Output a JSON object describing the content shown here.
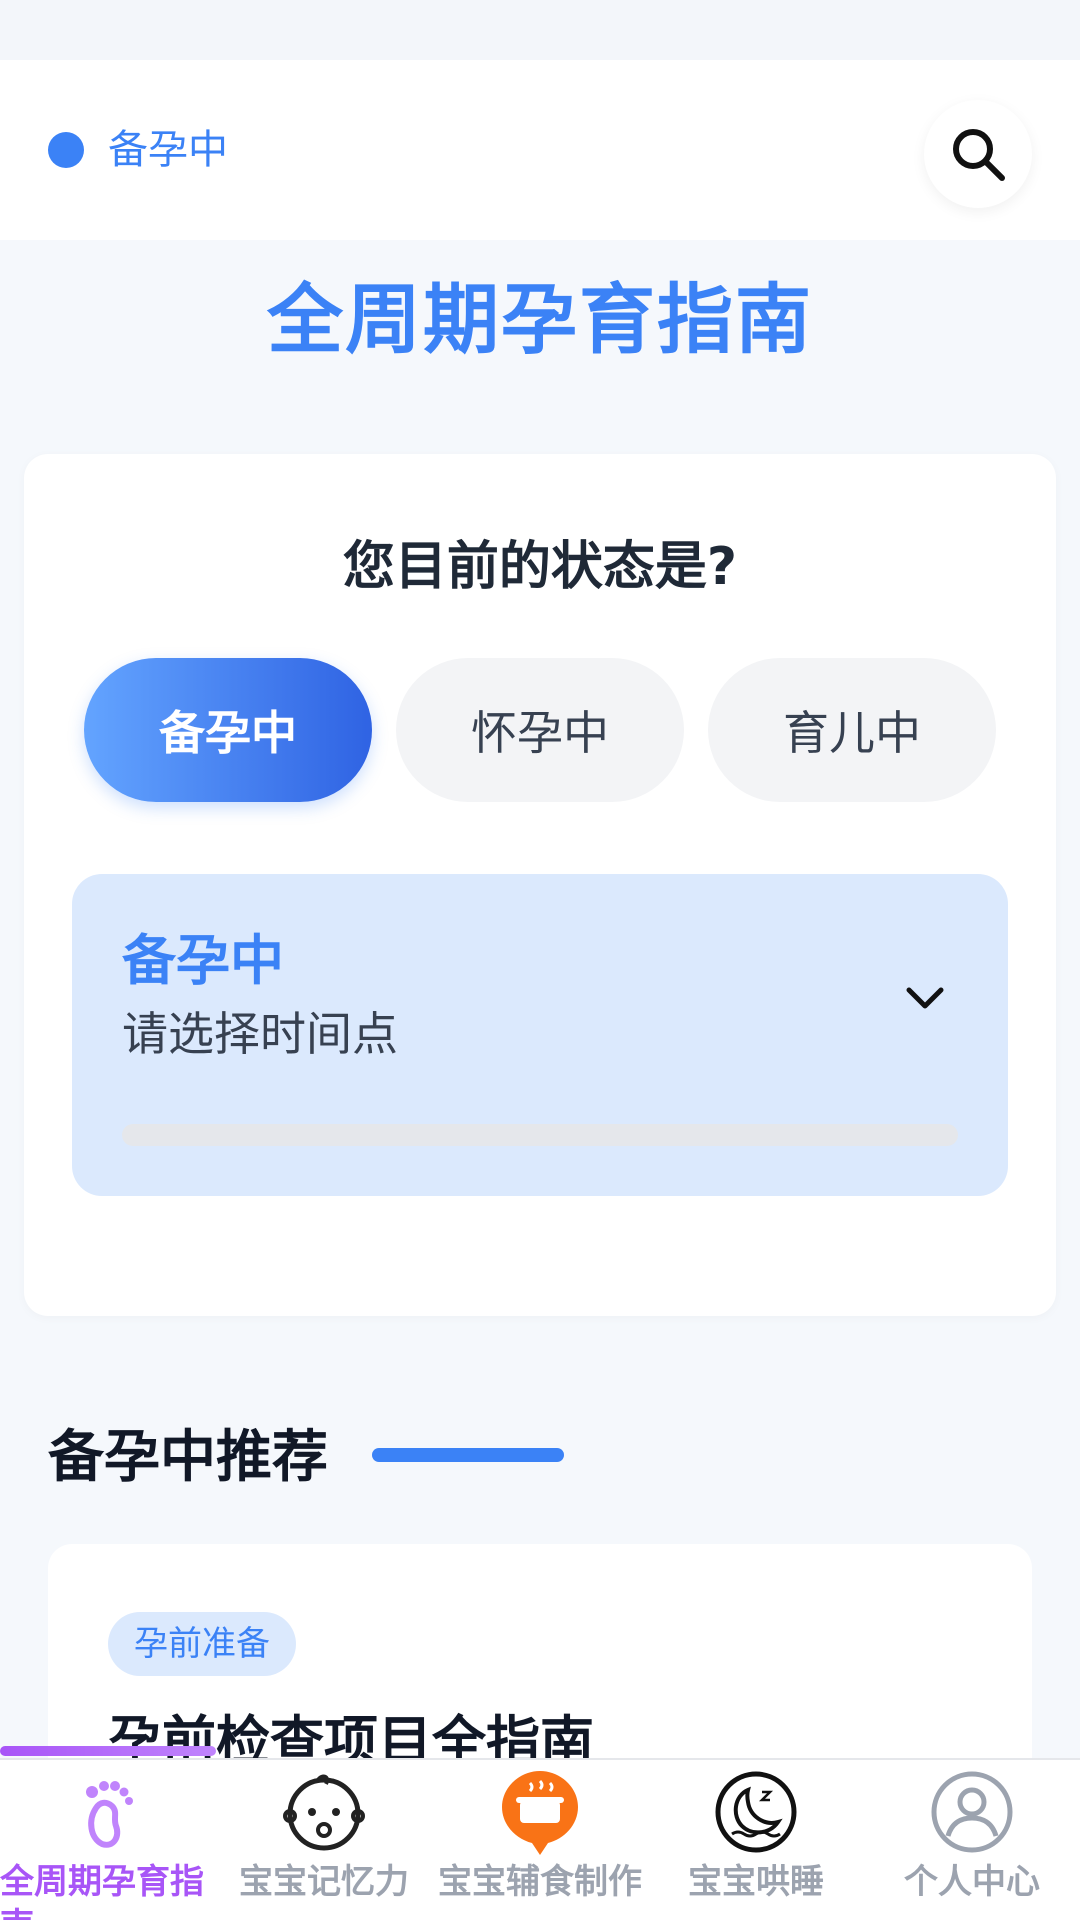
{
  "header": {
    "status_label": "备孕中",
    "dot_color": "#3b82f6",
    "search_icon": "search-icon"
  },
  "page_title": "全周期孕育指南",
  "state_selector": {
    "question": "您目前的状态是?",
    "options": [
      {
        "label": "备孕中",
        "selected": true
      },
      {
        "label": "怀孕中",
        "selected": false
      },
      {
        "label": "育儿中",
        "selected": false
      }
    ]
  },
  "time_panel": {
    "title": "备孕中",
    "subtitle": "请选择时间点",
    "progress": 0
  },
  "recommendations": {
    "title": "备孕中推荐",
    "articles": [
      {
        "tag": "孕前准备",
        "title": "孕前检查项目全指南"
      }
    ]
  },
  "bottom_nav": {
    "active_index": 0,
    "items": [
      {
        "label": "全周期孕育指南",
        "icon": "footprint-icon"
      },
      {
        "label": "宝宝记忆力",
        "icon": "baby-face-icon"
      },
      {
        "label": "宝宝辅食制作",
        "icon": "cooking-pot-icon"
      },
      {
        "label": "宝宝哄睡",
        "icon": "moon-sleep-icon"
      },
      {
        "label": "个人中心",
        "icon": "user-icon"
      }
    ]
  },
  "colors": {
    "accent": "#3b82f6",
    "nav_active": "#a855f7",
    "panel_bg": "#dbe9fd",
    "food_icon": "#f97316"
  }
}
